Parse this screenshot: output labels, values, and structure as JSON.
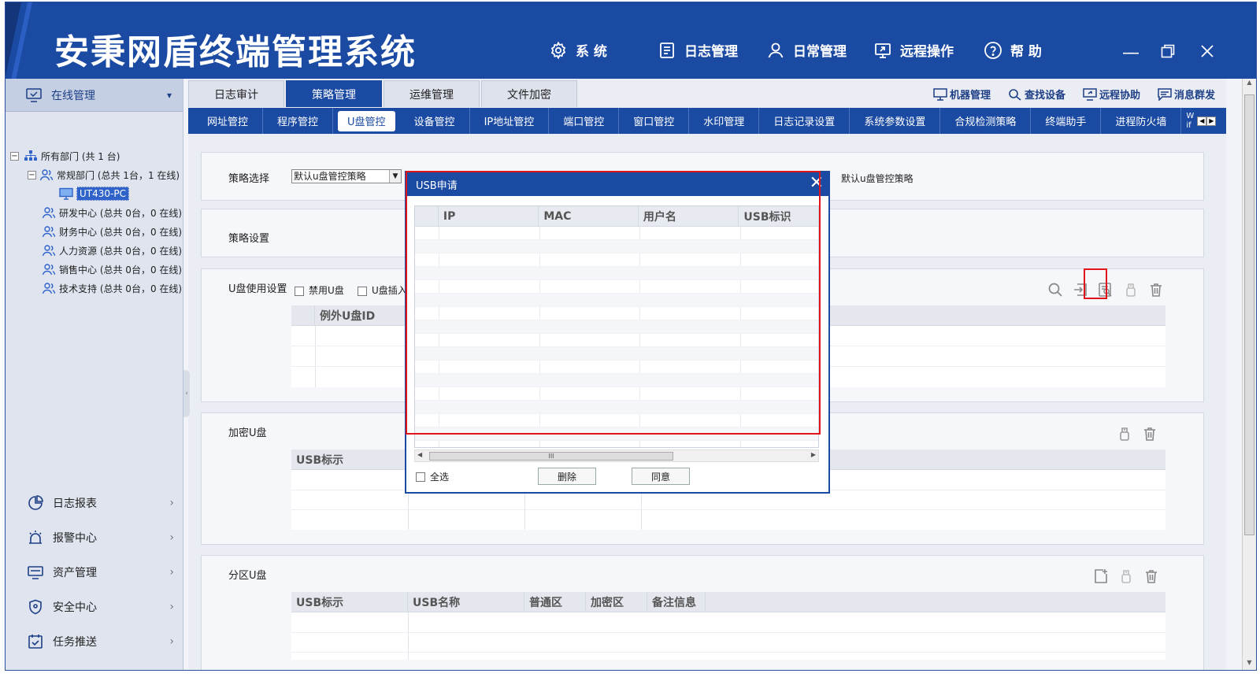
{
  "app": {
    "title": "安秉网盾终端管理系统",
    "menu": [
      {
        "label": "系 统",
        "icon": "gear-icon"
      },
      {
        "label": "日志管理",
        "icon": "log-icon"
      },
      {
        "label": "日常管理",
        "icon": "user-icon"
      },
      {
        "label": "远程操作",
        "icon": "remote-icon"
      },
      {
        "label": "帮 助",
        "icon": "help-icon"
      }
    ]
  },
  "sidebar": {
    "header": "在线管理",
    "tree": {
      "root": "所有部门 (共 1 台)",
      "group": "常规部门 (总共 1台，1 在线)",
      "pc": "UT430-PC",
      "departments": [
        "研发中心 (总共 0台，0 在线)",
        "财务中心 (总共 0台，0 在线)",
        "人力资源 (总共 0台，0 在线)",
        "销售中心 (总共 0台，0 在线)",
        "技术支持 (总共 0台，0 在线)"
      ]
    },
    "nav": [
      {
        "label": "日志报表",
        "icon": "chart-icon"
      },
      {
        "label": "报警中心",
        "icon": "alarm-icon"
      },
      {
        "label": "资产管理",
        "icon": "monitor-icon"
      },
      {
        "label": "安全中心",
        "icon": "shield-icon"
      },
      {
        "label": "任务推送",
        "icon": "task-icon"
      }
    ]
  },
  "tabs_top": [
    "日志审计",
    "策略管理",
    "运维管理",
    "文件加密"
  ],
  "tabs_top_active": "策略管理",
  "tools_right": [
    "机器管理",
    "查找设备",
    "远程协助",
    "消息群发"
  ],
  "tabs_sub": [
    "网址管控",
    "程序管控",
    "U盘管控",
    "设备管控",
    "IP地址管控",
    "端口管控",
    "窗口管控",
    "水印管理",
    "日志记录设置",
    "系统参数设置",
    "合规检测策略",
    "终端助手",
    "进程防火墙"
  ],
  "tabs_sub_active": "U盘管控",
  "tabs_sub_overflow": "W if",
  "policy": {
    "select_label": "策略选择",
    "select_value": "默认u盘管控策略",
    "current_policy": "默认u盘管控策略",
    "settings_label": "策略设置"
  },
  "usb_usage": {
    "label": "U盘使用设置",
    "disable_usb": "禁用U盘",
    "usb_insert": "U盘插入通",
    "grid_header": "例外U盘ID"
  },
  "encrypted": {
    "label": "加密U盘",
    "grid_header": "USB标示"
  },
  "partition": {
    "label": "分区U盘",
    "columns": [
      "USB标示",
      "USB名称",
      "普通区",
      "加密区",
      "备注信息"
    ]
  },
  "modal": {
    "title": "USB申请",
    "columns": [
      "IP",
      "MAC",
      "用户名",
      "USB标识"
    ],
    "select_all": "全选",
    "delete_btn": "删除",
    "agree_btn": "同意",
    "scroll_grip": "III"
  },
  "colors": {
    "primary": "#1b4aa3",
    "highlight": "#e0141a"
  }
}
